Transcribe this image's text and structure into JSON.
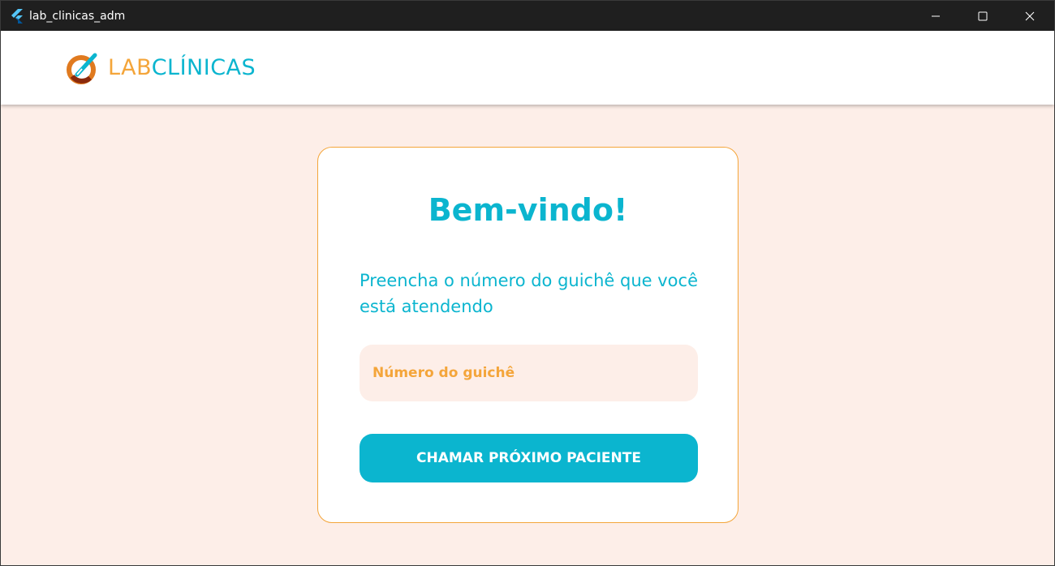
{
  "window": {
    "title": "lab_clinicas_adm"
  },
  "header": {
    "logo_part1": "LAB",
    "logo_part2": "CLÍNICAS"
  },
  "card": {
    "title": "Bem-vindo!",
    "subtitle": "Preencha o número do guichê que você está atendendo",
    "input_placeholder": "Número do guichê",
    "input_value": "",
    "button_label": "CHAMAR PRÓXIMO PACIENTE"
  },
  "colors": {
    "accent_cyan": "#0bb5cf",
    "accent_orange": "#f4a53a",
    "background": "#fdeee8"
  },
  "icons": {
    "app": "flutter-icon",
    "minimize": "minimize-icon",
    "maximize": "maximize-icon",
    "close": "close-icon",
    "logo": "labclinicas-logo-icon"
  }
}
